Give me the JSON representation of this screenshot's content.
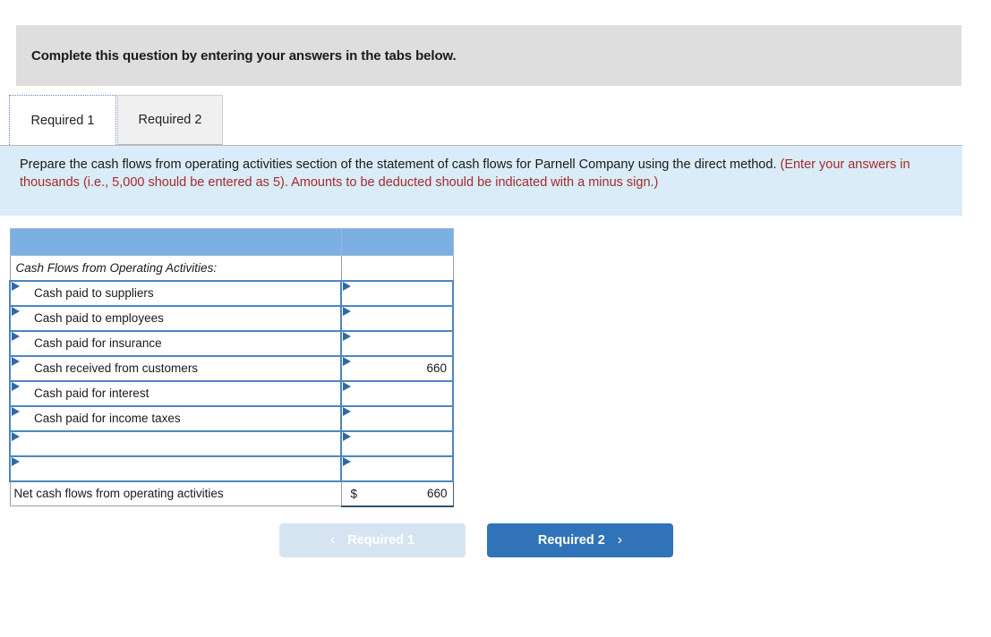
{
  "banner": {
    "text": "Complete this question by entering your answers in the tabs below."
  },
  "tabs": [
    {
      "label": "Required 1",
      "active": true
    },
    {
      "label": "Required 2",
      "active": false
    }
  ],
  "instructions": {
    "black_part": "Prepare the cash flows from operating activities section of the statement of cash flows for Parnell Company using the direct method. ",
    "red_part": "(Enter your answers in thousands (i.e., 5,000 should be entered as 5). Amounts to be deducted should be indicated with a minus sign.)"
  },
  "worksheet": {
    "header_row_label": "",
    "header_row_value": "",
    "section_title": "Cash Flows from Operating Activities:",
    "rows": [
      {
        "label": "Cash paid to suppliers",
        "value": ""
      },
      {
        "label": "Cash paid to employees",
        "value": ""
      },
      {
        "label": "Cash paid for insurance",
        "value": ""
      },
      {
        "label": "Cash received from customers",
        "value": "660"
      },
      {
        "label": "Cash paid for interest",
        "value": ""
      },
      {
        "label": "Cash paid for income taxes",
        "value": ""
      },
      {
        "label": "",
        "value": ""
      },
      {
        "label": "",
        "value": ""
      }
    ],
    "total": {
      "label": "Net cash flows from operating activities",
      "currency": "$",
      "value": "660"
    }
  },
  "nav": {
    "prev_label": "Required 1",
    "prev_icon": "chevron-left-icon",
    "prev_chevron": "‹",
    "next_label": "Required 2",
    "next_icon": "chevron-right-icon",
    "next_chevron": "›"
  },
  "colors": {
    "banner_bg": "#dedede",
    "info_bg": "#d9ecf8",
    "table_header_blue": "#7cafe2",
    "cell_border_blue": "#4e86bf",
    "btn_active_blue": "#3173b8",
    "btn_disabled_blue": "#d6e4f2",
    "red_text": "#a62a2a"
  }
}
